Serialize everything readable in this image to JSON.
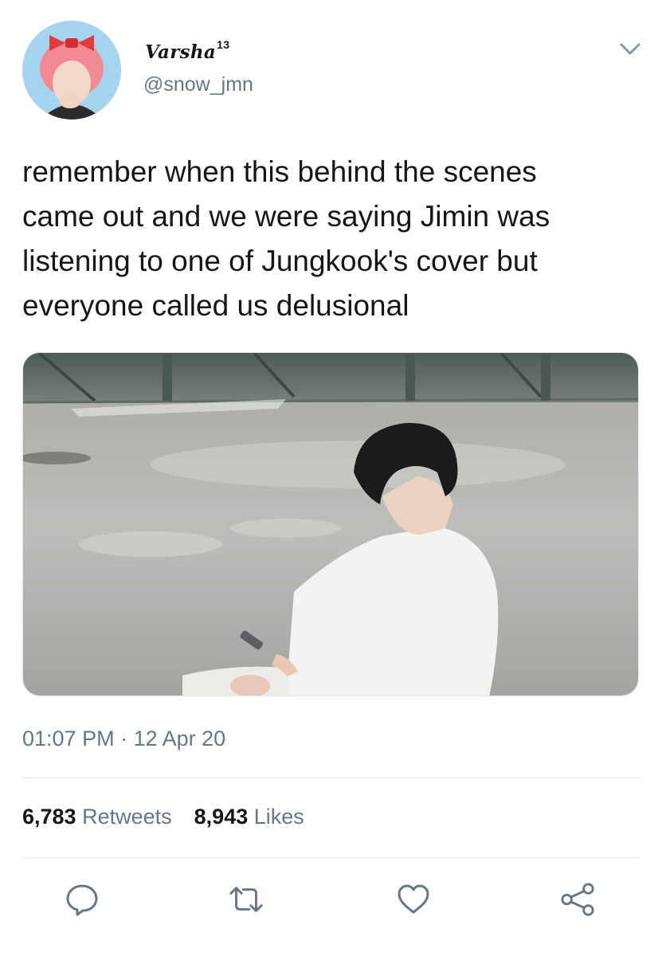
{
  "user": {
    "display_name": "Varsha",
    "display_name_sup": "13",
    "handle": "@snow_jmn"
  },
  "tweet": {
    "text": "remember when this behind the scenes\ncame out and we were saying Jimin was\nlistening to one of Jungkook's cover but\neveryone called us delusional",
    "time": "01:07 PM",
    "separator": "·",
    "date": "12 Apr 20"
  },
  "stats": {
    "retweets_count": "6,783",
    "retweets_label": "Retweets",
    "likes_count": "8,943",
    "likes_label": "Likes"
  },
  "actions": [
    {
      "icon": "reply-icon"
    },
    {
      "icon": "retweet-icon"
    },
    {
      "icon": "like-icon"
    },
    {
      "icon": "share-icon"
    }
  ],
  "colors": {
    "secondary_text": "#657786",
    "primary_text": "#14171a",
    "divider": "#e1e8ed"
  }
}
